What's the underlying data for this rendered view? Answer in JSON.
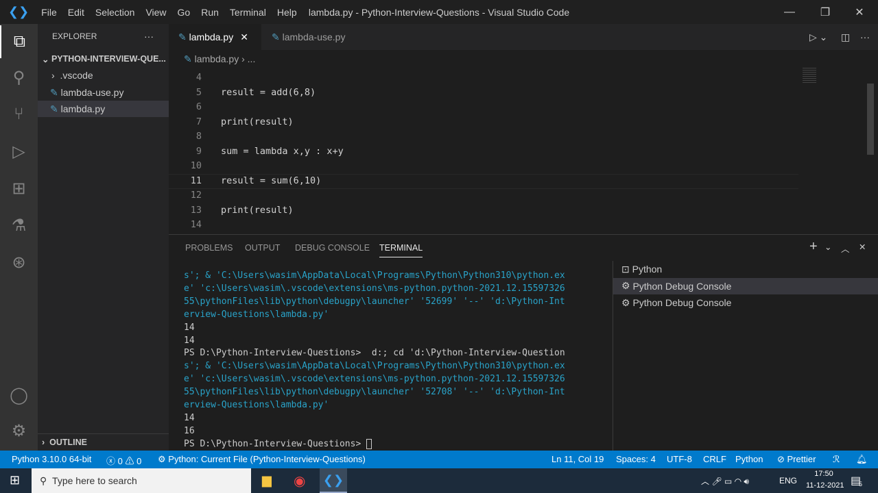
{
  "window": {
    "title": "lambda.py - Python-Interview-Questions - Visual Studio Code",
    "menu": [
      "File",
      "Edit",
      "Selection",
      "View",
      "Go",
      "Run",
      "Terminal",
      "Help"
    ]
  },
  "sidebar": {
    "title": "EXPLORER",
    "folder": "PYTHON-INTERVIEW-QUE...",
    "items": [
      {
        "label": ".vscode"
      },
      {
        "label": "lambda-use.py"
      },
      {
        "label": "lambda.py"
      }
    ],
    "outline": "OUTLINE"
  },
  "tabs": [
    {
      "label": "lambda.py",
      "active": true
    },
    {
      "label": "lambda-use.py",
      "active": false
    }
  ],
  "breadcrumb": {
    "file": "lambda.py",
    "more": "..."
  },
  "editor": {
    "lines": [
      {
        "n": "4",
        "code": ""
      },
      {
        "n": "5",
        "code": "result = add(6,8)"
      },
      {
        "n": "6",
        "code": ""
      },
      {
        "n": "7",
        "code": "print(result)"
      },
      {
        "n": "8",
        "code": ""
      },
      {
        "n": "9",
        "code": "sum = lambda x,y : x+y"
      },
      {
        "n": "10",
        "code": ""
      },
      {
        "n": "11",
        "code": "result = sum(6,10)"
      },
      {
        "n": "12",
        "code": ""
      },
      {
        "n": "13",
        "code": "print(result)"
      },
      {
        "n": "14",
        "code": ""
      }
    ]
  },
  "panel": {
    "tabs": [
      "PROBLEMS",
      "OUTPUT",
      "DEBUG CONSOLE",
      "TERMINAL"
    ],
    "active": "TERMINAL",
    "terminal": [
      "s'; & 'C:\\Users\\wasim\\AppData\\Local\\Programs\\Python\\Python310\\python.ex",
      "e' 'c:\\Users\\wasim\\.vscode\\extensions\\ms-python.python-2021.12.15597326",
      "55\\pythonFiles\\lib\\python\\debugpy\\launcher' '52699' '--' 'd:\\Python-Int",
      "erview-Questions\\lambda.py'",
      "14",
      "14",
      "PS D:\\Python-Interview-Questions>  d:; cd 'd:\\Python-Interview-Question",
      "s'; & 'C:\\Users\\wasim\\AppData\\Local\\Programs\\Python\\Python310\\python.ex",
      "e' 'c:\\Users\\wasim\\.vscode\\extensions\\ms-python.python-2021.12.15597326",
      "55\\pythonFiles\\lib\\python\\debugpy\\launcher' '52708' '--' 'd:\\Python-Int",
      "erview-Questions\\lambda.py'",
      "14",
      "16",
      "PS D:\\Python-Interview-Questions> "
    ],
    "terminals": [
      "Python",
      "Python Debug Console",
      "Python Debug Console"
    ]
  },
  "status": {
    "interpreter": "Python 3.10.0 64-bit",
    "errors": "0",
    "warnings": "0",
    "run": "Python: Current File (Python-Interview-Questions)",
    "position": "Ln 11, Col 19",
    "spaces": "Spaces: 4",
    "encoding": "UTF-8",
    "eol": "CRLF",
    "language": "Python",
    "prettier": "Prettier"
  },
  "taskbar": {
    "search_placeholder": "Type here to search",
    "time": "17:50",
    "date": "11-12-2021",
    "lang": "ENG",
    "notifications": "5"
  }
}
